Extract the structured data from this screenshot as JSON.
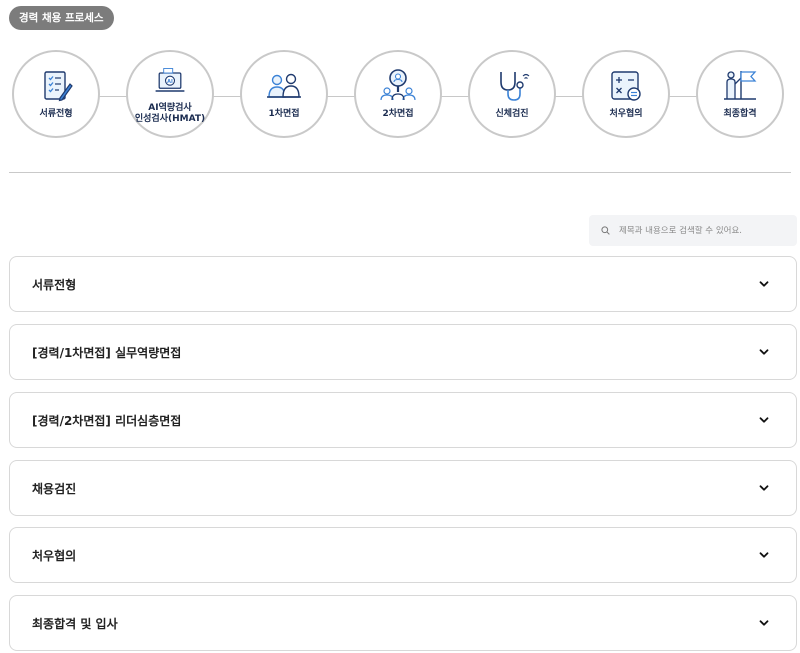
{
  "header": {
    "badge": "경력 채용 프로세스"
  },
  "steps": [
    {
      "label": "서류전형",
      "icon": "document-pen-icon"
    },
    {
      "label": "AI역량검사\n인성검사(HMAT)",
      "icon": "ai-laptop-icon"
    },
    {
      "label": "1차면접",
      "icon": "two-people-icon"
    },
    {
      "label": "2차면접",
      "icon": "magnifier-people-icon"
    },
    {
      "label": "신체검진",
      "icon": "stethoscope-icon"
    },
    {
      "label": "처우협의",
      "icon": "calculator-icon"
    },
    {
      "label": "최종합격",
      "icon": "person-flag-icon"
    }
  ],
  "search": {
    "placeholder": "제목과 내용으로 검색할 수 있어요."
  },
  "accordion": [
    {
      "title": "서류전형"
    },
    {
      "title": "[경력/1차면접] 실무역량면접"
    },
    {
      "title": "[경력/2차면접] 리더심층면접"
    },
    {
      "title": "채용검진"
    },
    {
      "title": "처우협의"
    },
    {
      "title": "최종합격 및 입사"
    }
  ],
  "colors": {
    "icon_navy": "#1f3a6e",
    "icon_blue": "#3b82d6",
    "badge_bg": "#7c7c7c"
  }
}
